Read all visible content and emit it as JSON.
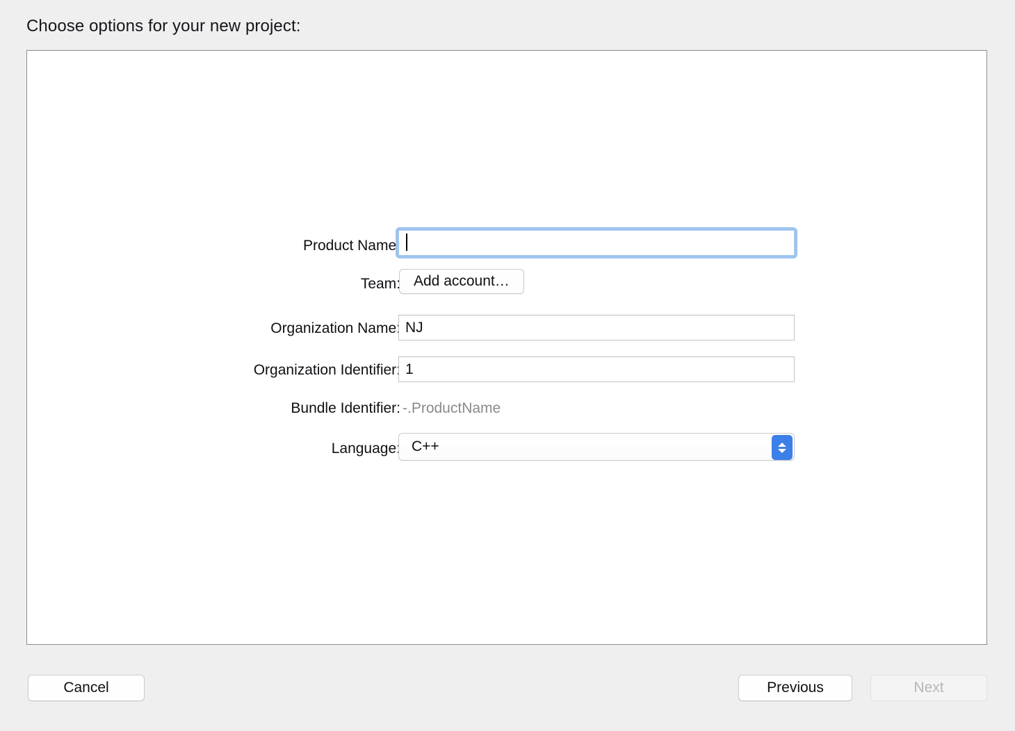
{
  "heading": "Choose options for your new project:",
  "form": {
    "rows": [
      {
        "label": "Product Name:",
        "kind": "textfield",
        "value": "",
        "focused": true
      },
      {
        "label": "Team:",
        "kind": "button",
        "value": "Add account…"
      },
      {
        "label": "Organization Name:",
        "kind": "textfield",
        "value": "NJ",
        "focused": false
      },
      {
        "label": "Organization Identifier:",
        "kind": "textfield",
        "value": "1",
        "focused": false
      },
      {
        "label": "Bundle Identifier:",
        "kind": "static",
        "value": "-.ProductName"
      },
      {
        "label": "Language:",
        "kind": "popup",
        "value": "C++"
      }
    ]
  },
  "footer": {
    "cancel_label": "Cancel",
    "previous_label": "Previous",
    "next_label": "Next"
  },
  "colors": {
    "background": "#efeff0",
    "panel": "#ffffff",
    "panel_border": "#8d8d8d",
    "focus_ring": "#9dc4ef",
    "popup_accent": "#3d7fe8",
    "label_text": "#101014",
    "disabled_text": "#b6b6ba",
    "placeholder_text": "#8a8a8e"
  },
  "icons": {
    "popup_stepper": "chevron-up-down-icon",
    "text_caret": "text-caret-icon"
  }
}
